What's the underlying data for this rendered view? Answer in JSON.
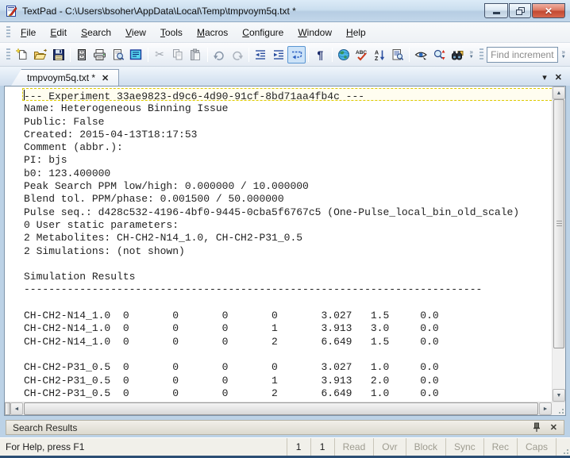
{
  "window": {
    "title": "TextPad - C:\\Users\\bsoher\\AppData\\Local\\Temp\\tmpvoym5q.txt *"
  },
  "menu": {
    "items": [
      "File",
      "Edit",
      "Search",
      "View",
      "Tools",
      "Macros",
      "Configure",
      "Window",
      "Help"
    ]
  },
  "toolbar": {
    "find_placeholder": "Find incrementally",
    "icons": [
      "new-file",
      "open-file",
      "save",
      "document-drawer",
      "print",
      "print-preview",
      "clip-library",
      "cut",
      "copy",
      "paste",
      "undo",
      "redo",
      "outdent",
      "indent",
      "word-wrap",
      "formatting-marks",
      "web-browse",
      "spell-check",
      "sort-az",
      "find-in-files",
      "view-search",
      "replace",
      "find-in-browser"
    ]
  },
  "tab_bar": {
    "active_tab": "tmpvoym5q.txt *"
  },
  "editor": {
    "lines": [
      "--- Experiment 33ae9823-d9c6-4d90-91cf-8bd71aa4fb4c ---",
      "Name: Heterogeneous Binning Issue",
      "Public: False",
      "Created: 2015-04-13T18:17:53",
      "Comment (abbr.):",
      "PI: bjs",
      "b0: 123.400000",
      "Peak Search PPM low/high: 0.000000 / 10.000000",
      "Blend tol. PPM/phase: 0.001500 / 50.000000",
      "Pulse seq.: d428c532-4196-4bf0-9445-0cba5f6767c5 (One-Pulse_local_bin_old_scale)",
      "0 User static parameters:",
      "2 Metabolites: CH-CH2-N14_1.0, CH-CH2-P31_0.5",
      "2 Simulations: (not shown)",
      "",
      "Simulation Results",
      "--------------------------------------------------------------------------",
      "",
      "CH-CH2-N14_1.0  0       0       0       0       3.027   1.5     0.0",
      "CH-CH2-N14_1.0  0       0       0       1       3.913   3.0     0.0",
      "CH-CH2-N14_1.0  0       0       0       2       6.649   1.5     0.0",
      "",
      "CH-CH2-P31_0.5  0       0       0       0       3.027   1.0     0.0",
      "CH-CH2-P31_0.5  0       0       0       1       3.913   2.0     0.0",
      "CH-CH2-P31_0.5  0       0       0       2       6.649   1.0     0.0"
    ]
  },
  "search_panel": {
    "title": "Search Results"
  },
  "status_bar": {
    "help_text": "For Help, press F1",
    "line": "1",
    "column": "1",
    "indicators": [
      "Read",
      "Ovr",
      "Block",
      "Sync",
      "Rec",
      "Caps"
    ]
  },
  "colors": {
    "window_frame": "#2b4e74",
    "title_bar": "#c6d9ec",
    "close_button": "#cf5a41",
    "client_background": "#bcd2e6",
    "toolbar_active_highlight": "#cde3f8",
    "current_line_dash": "#ddc900",
    "editor_background": "#ffffff",
    "editor_text": "#222222",
    "status_inactive_text": "#9e9c90"
  }
}
